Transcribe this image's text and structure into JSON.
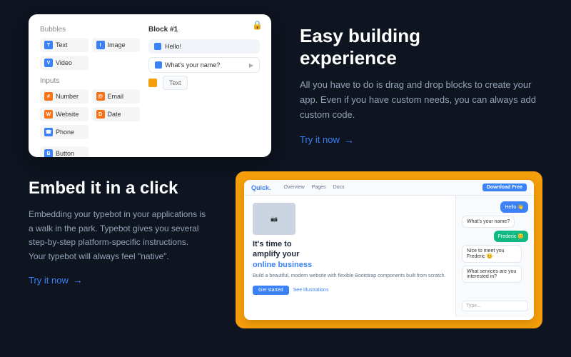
{
  "top": {
    "section_title_line1": "Easy building",
    "section_title_line2": "experience",
    "description": "All you have to do is drag and drop blocks to create your app. Even if you have custom needs, you can always add custom code.",
    "try_link": "Try it now",
    "builder": {
      "bubbles_label": "Bubbles",
      "inputs_label": "Inputs",
      "blocks": [
        {
          "label": "Text",
          "icon": "T",
          "color": "blue"
        },
        {
          "label": "Image",
          "icon": "I",
          "color": "blue"
        },
        {
          "label": "Video",
          "icon": "V",
          "color": "blue"
        },
        {
          "label": "Number",
          "icon": "#",
          "color": "orange"
        },
        {
          "label": "Email",
          "icon": "@",
          "color": "orange"
        },
        {
          "label": "Website",
          "icon": "W",
          "color": "orange"
        },
        {
          "label": "Date",
          "icon": "D",
          "color": "orange"
        },
        {
          "label": "Phone",
          "icon": "P",
          "color": "blue"
        },
        {
          "label": "Button",
          "icon": "B",
          "color": "blue"
        }
      ],
      "block_number": "Block #1",
      "chat1": "Hello!",
      "chat2": "What's your name?",
      "dropdown_text": "Text"
    }
  },
  "bottom": {
    "section_title": "Embed it in a click",
    "description": "Embedding your typebot in your applications is a walk in the park. Typebot gives you several step-by-step platform-specific instructions. Your typebot will always feel \"native\".",
    "try_link": "Try it now",
    "browser": {
      "logo": "Quick.",
      "nav_items": [
        "Overview",
        "Pages",
        "Docs"
      ],
      "cta_button": "Download Free",
      "main_title_line1": "It's time to",
      "main_title_line2": "amplify your",
      "main_title_highlight": "online business",
      "main_desc": "Build a beautiful, modern website with flexible Bootstrap components built from scratch.",
      "btn_started": "Get started",
      "btn_illustrations": "See Illustrations",
      "chat_messages": [
        {
          "text": "Hello 👋",
          "side": "right"
        },
        {
          "text": "What's your name?",
          "side": "left"
        },
        {
          "text": "Frederic 😊",
          "side": "right-green"
        },
        {
          "text": "Nice to meet you Frederic 😊",
          "side": "left"
        },
        {
          "text": "What services are you interested in?",
          "side": "left"
        }
      ]
    }
  }
}
